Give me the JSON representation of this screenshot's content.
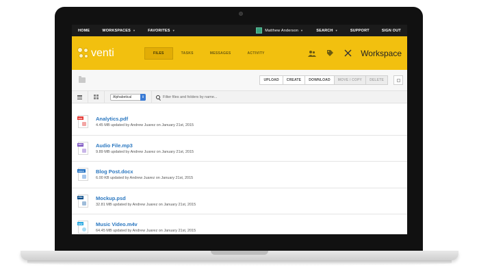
{
  "topnav": {
    "items": [
      "HOME",
      "WORKSPACES",
      "FAVORITES"
    ],
    "user_name": "Matthew Anderson",
    "right_items": [
      "SEARCH",
      "SUPPORT",
      "SIGN OUT"
    ]
  },
  "brand": {
    "logo_text": "venti",
    "tabs": [
      "FILES",
      "TASKS",
      "MESSAGES",
      "ACTIVITY"
    ],
    "active_tab": "FILES",
    "title": "Workspace",
    "icons": [
      "users-icon",
      "tag-icon",
      "tools-icon"
    ],
    "color": "#f2c00f"
  },
  "toolbar": {
    "buttons": [
      "UPLOAD",
      "CREATE",
      "DOWNLOAD",
      "MOVE / COPY",
      "DELETE"
    ],
    "disabled": [
      "MOVE / COPY",
      "DELETE"
    ]
  },
  "filter": {
    "sort_value": "Alphabetical",
    "placeholder": "Filter files and folders by name..."
  },
  "files": [
    {
      "name": "Analytics.pdf",
      "meta": "4.45 MB updated by Andrew Juarez on January 21st, 2015",
      "tag": "PDF",
      "color": "#e53935"
    },
    {
      "name": "Audio File.mp3",
      "meta": "9.89 MB updated by Andrew Juarez on January 21st, 2015",
      "tag": "MP3",
      "color": "#7e57c2"
    },
    {
      "name": "Blog Post.docx",
      "meta": "6.00 KB updated by Andrew Juarez on January 21st, 2015",
      "tag": "DOCX",
      "color": "#1e6fc2"
    },
    {
      "name": "Mockup.psd",
      "meta": "32.81 MB updated by Andrew Juarez on January 21st, 2015",
      "tag": "PSD",
      "color": "#0d4f8b"
    },
    {
      "name": "Music Video.m4v",
      "meta": "64.45 MB updated by Andrew Juarez on January 21st, 2015",
      "tag": "M4V",
      "color": "#29a8e0"
    }
  ]
}
